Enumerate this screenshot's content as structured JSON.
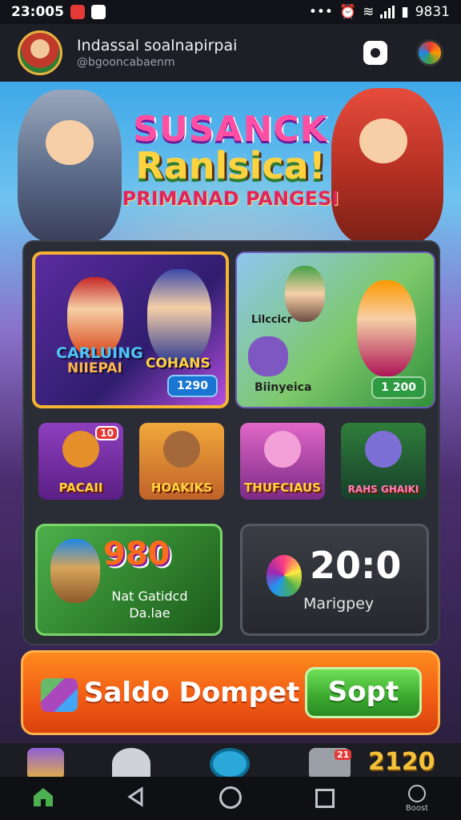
{
  "status_bar": {
    "time": "23:005",
    "right_text": "9831"
  },
  "app_bar": {
    "title": "Indassal soalnapirpai",
    "subtitle": "@bgooncabaenm"
  },
  "banner": {
    "line1": "SUSANCK",
    "line2": "Ranlsica!",
    "line3": "PRIMANAD PANGESI"
  },
  "featured": [
    {
      "title_a": "CARLUING",
      "title_b": "NIIEPAI",
      "title_c": "COHANS",
      "price": "1290"
    },
    {
      "title_a": "Lilccicr",
      "title_b": "Biinyeica",
      "price": "1 200"
    }
  ],
  "tiles": [
    {
      "label": "PACAII",
      "badge": "10"
    },
    {
      "label": "HOAKIKS"
    },
    {
      "label": "THUFCIAUS"
    },
    {
      "label": "RAHS GHAIKI"
    }
  ],
  "cards": {
    "green": {
      "number": "980",
      "text_line1": "Nat Gatidcd",
      "text_line2": "Da.lae"
    },
    "dark": {
      "number": "20:0",
      "text": "Marigpey"
    }
  },
  "wallet": {
    "label": "Saldo Dompet",
    "button": "Sopt"
  },
  "hotbar": {
    "badge": "21",
    "number": "2120"
  },
  "nav": {
    "boost_label": "Boost"
  },
  "colors": {
    "accent_orange": "#f05a14",
    "accent_green": "#3ba82f",
    "gold": "#f5b331"
  }
}
